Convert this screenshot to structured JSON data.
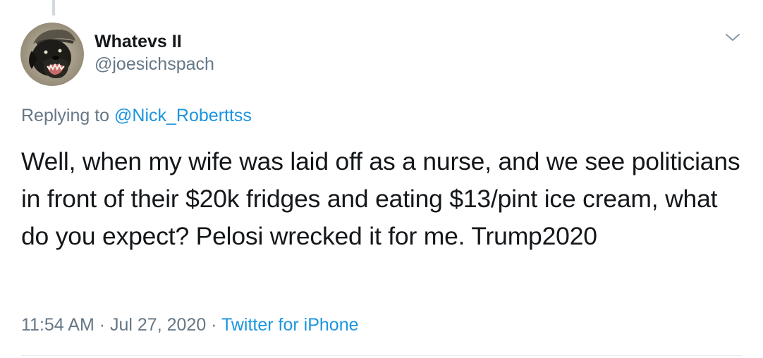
{
  "user": {
    "display_name": "Whatevs II",
    "handle": "@joesichspach",
    "avatar_icon": "dog-with-cap-avatar"
  },
  "reply": {
    "prefix": "Replying to ",
    "mention": "@Nick_Roberttss"
  },
  "tweet": {
    "text": "Well, when my wife was laid off as a nurse, and we see politicians in front of their $20k fridges and eating $13/pint ice cream, what do you expect? Pelosi wrecked it for me. Trump2020"
  },
  "meta": {
    "time": "11:54 AM",
    "separator": " · ",
    "date": "Jul 27, 2020",
    "source": "Twitter for iPhone"
  },
  "icons": {
    "menu": "chevron-down-icon"
  },
  "colors": {
    "link": "#1b95e0",
    "secondary_text": "#657786",
    "primary_text": "#14171a"
  }
}
